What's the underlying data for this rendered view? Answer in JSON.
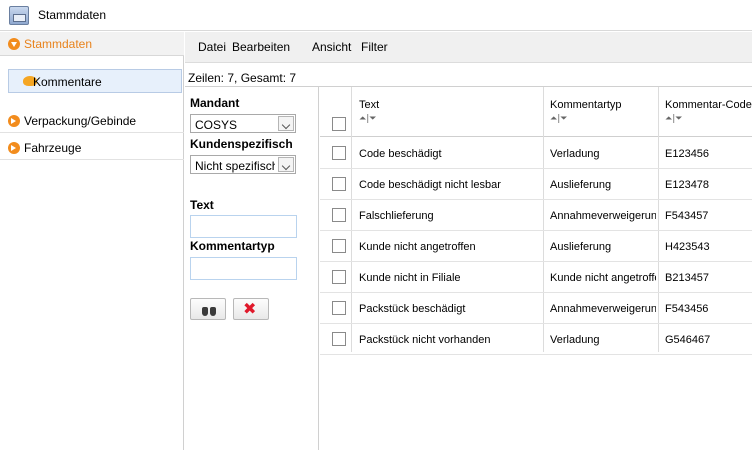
{
  "window": {
    "title": "Stammdaten"
  },
  "sidebar": {
    "sections": [
      {
        "label": "Stammdaten",
        "active": true
      },
      {
        "label": "Verpackung/Gebinde",
        "active": false
      },
      {
        "label": "Fahrzeuge",
        "active": false
      }
    ],
    "subitems": [
      {
        "label": "Kommentare",
        "selected": true
      }
    ]
  },
  "menu": {
    "items": [
      "Datei",
      "Bearbeiten",
      "Ansicht",
      "Filter"
    ]
  },
  "grid_info": {
    "row_count": "Zeilen: 7, Gesamt: 7"
  },
  "filter": {
    "mandant": {
      "label": "Mandant",
      "value": "COSYS"
    },
    "kundenspezifisch": {
      "label": "Kundenspezifisch",
      "value": "Nicht spezifisch"
    },
    "text": {
      "label": "Text",
      "value": ""
    },
    "kommentartyp": {
      "label": "Kommentartyp",
      "value": ""
    },
    "buttons": {
      "search_icon": "binoculars-icon",
      "clear_icon": "red-x-icon"
    }
  },
  "table": {
    "columns": [
      "Text",
      "Kommentartyp",
      "Kommentar-Code"
    ],
    "sort_indicator": "⏶|⏷",
    "rows": [
      {
        "text": "Code beschädigt",
        "typ": "Verladung",
        "code": "E123456"
      },
      {
        "text": "Code beschädigt nicht lesbar",
        "typ": "Auslieferung",
        "code": "E123478"
      },
      {
        "text": "Falschlieferung",
        "typ": "Annahmeverweigerung",
        "code": "F543457"
      },
      {
        "text": "Kunde nicht angetroffen",
        "typ": "Auslieferung",
        "code": "H423543"
      },
      {
        "text": "Kunde nicht in Filiale",
        "typ": "Kunde nicht angetroffen",
        "code": "B213457"
      },
      {
        "text": "Packstück beschädigt",
        "typ": "Annahmeverweigerung",
        "code": "F543456"
      },
      {
        "text": "Packstück nicht vorhanden",
        "typ": "Verladung",
        "code": "G546467"
      }
    ]
  },
  "colors": {
    "accent": "#f28c1d",
    "selection": "#e7f0fb"
  }
}
